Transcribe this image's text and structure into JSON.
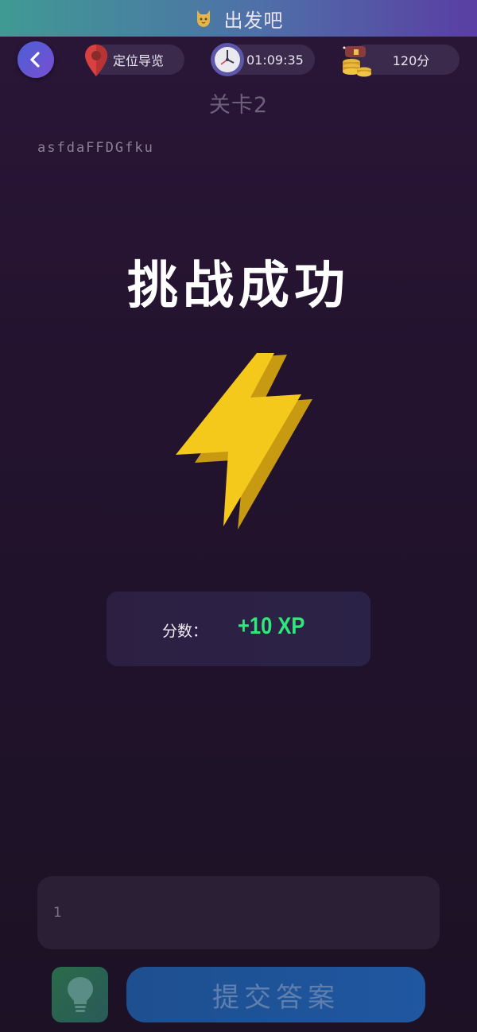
{
  "header": {
    "title": "出发吧",
    "app_icon": "cat-mascot-icon"
  },
  "topbar": {
    "back_icon": "chevron-left-icon",
    "nav_label": "定位导览",
    "nav_icon": "location-pin-icon",
    "timer": "01:09:35",
    "timer_icon": "clock-icon",
    "score": "120分",
    "score_icon": "treasure-chest-icon"
  },
  "level": {
    "title": "关卡2",
    "question": "asfdaFFDGfku"
  },
  "result": {
    "title": "挑战成功",
    "icon": "lightning-bolt-icon",
    "score_label": "分数：",
    "score_value": "+10 XP"
  },
  "answer": {
    "value": "1"
  },
  "actions": {
    "hint_icon": "lightbulb-icon",
    "submit_label": "提交答案"
  },
  "colors": {
    "background": "#24132f",
    "xp_green": "#2ee87a",
    "bolt_yellow": "#f5c91c",
    "submit_blue": "#1f57a0"
  }
}
